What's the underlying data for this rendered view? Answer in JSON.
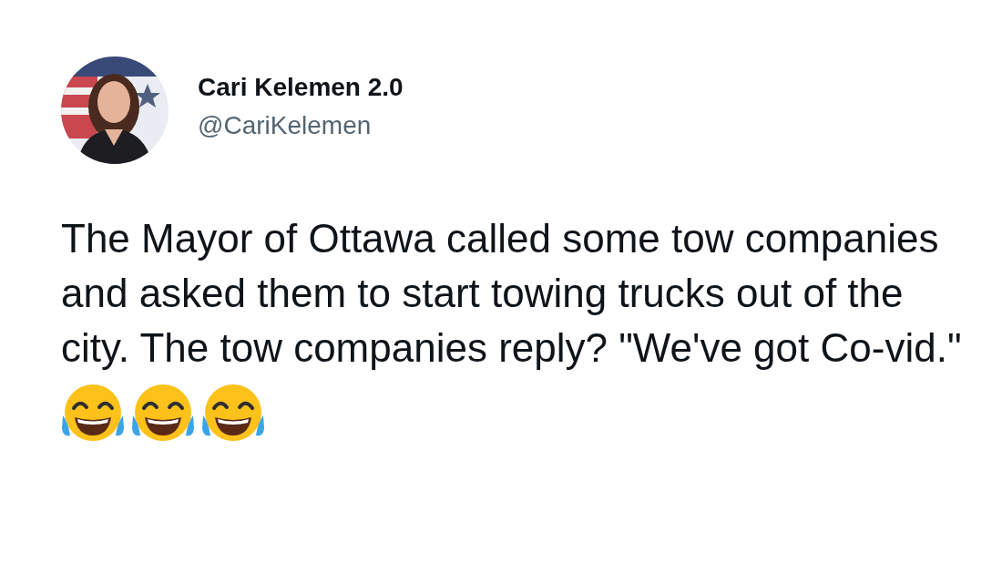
{
  "author": {
    "name": "Cari Kelemen 2.0",
    "handle": "@CariKelemen"
  },
  "tweet": {
    "text": "The Mayor of Ottawa called some tow companies and asked them to start towing trucks out of the city. The tow companies reply? \"We've got Co-vid.\"",
    "emojis": [
      {
        "kind": "tears_of_joy"
      },
      {
        "kind": "tears_of_joy"
      },
      {
        "kind": "tears_of_joy"
      }
    ]
  }
}
